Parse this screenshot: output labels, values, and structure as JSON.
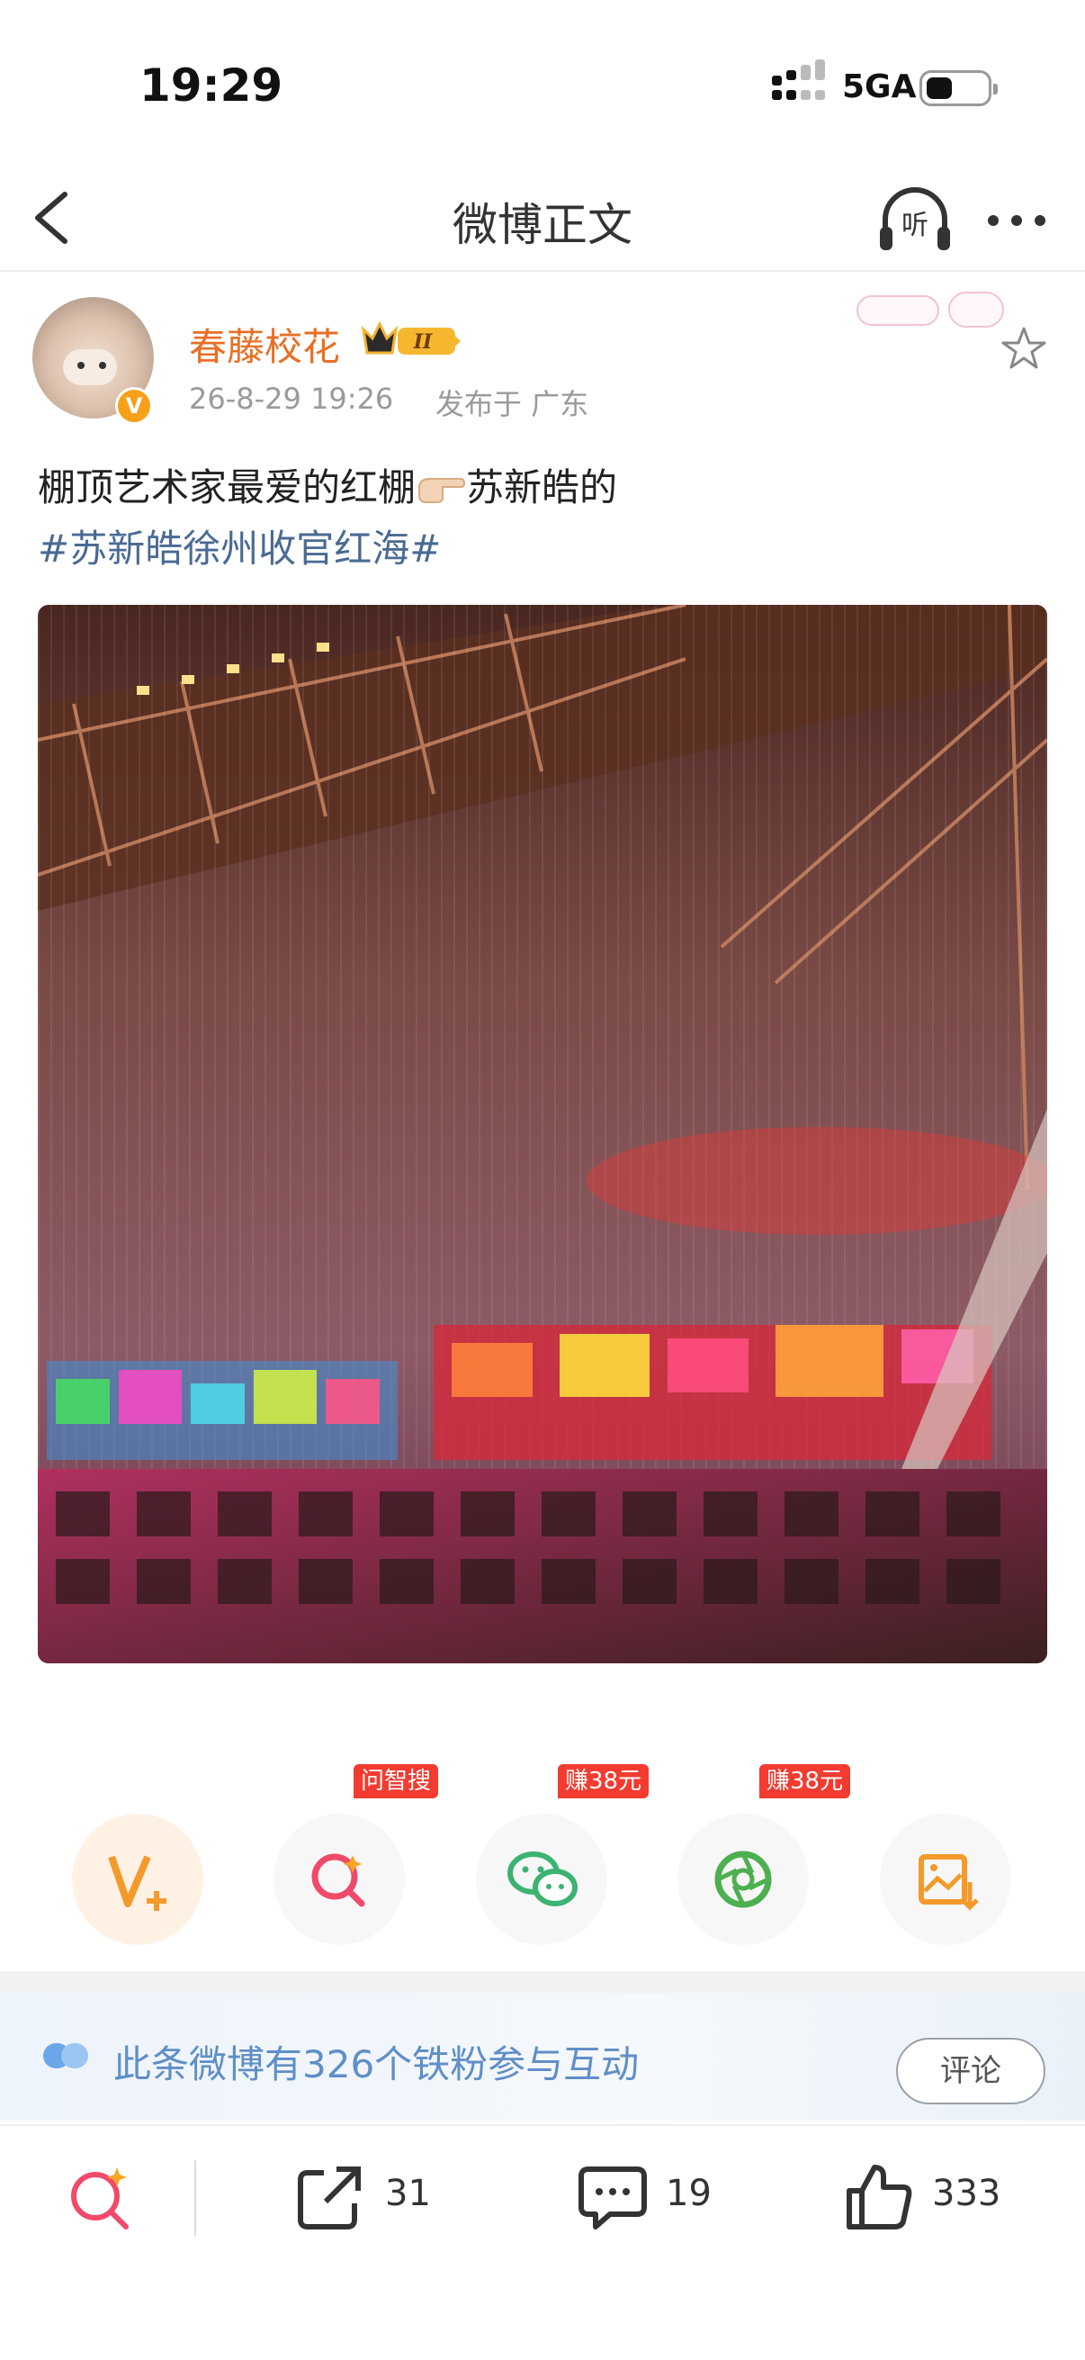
{
  "status_bar": {
    "time": "19:29",
    "network": "5GA"
  },
  "nav": {
    "title": "微博正文",
    "listen_label": "听"
  },
  "post": {
    "username": "春藤校花",
    "level": "II",
    "timestamp": "26-8-29 19:26",
    "location": "发布于 广东",
    "text_before": "棚顶艺术家最爱的红棚",
    "text_after": "苏新皓的",
    "hashtag": "#苏新皓徐州收官红海#"
  },
  "actions": [
    {
      "name": "v-plus",
      "tag": ""
    },
    {
      "name": "smart-search",
      "tag": "问智搜"
    },
    {
      "name": "wechat-share",
      "tag": "赚38元"
    },
    {
      "name": "moments-share",
      "tag": "赚38元"
    },
    {
      "name": "save-image",
      "tag": ""
    }
  ],
  "fans_banner": {
    "text": "此条微博有326个铁粉参与互动",
    "comment_button": "评论"
  },
  "toolbar": {
    "repost_count": "31",
    "comment_count": "19",
    "like_count": "333"
  },
  "colors": {
    "username": "#e86f25",
    "hashtag": "#4a6a94",
    "fans_text": "#5f8fc7",
    "tag_red": "#f33b30",
    "orange_accent": "#f39a2b"
  }
}
